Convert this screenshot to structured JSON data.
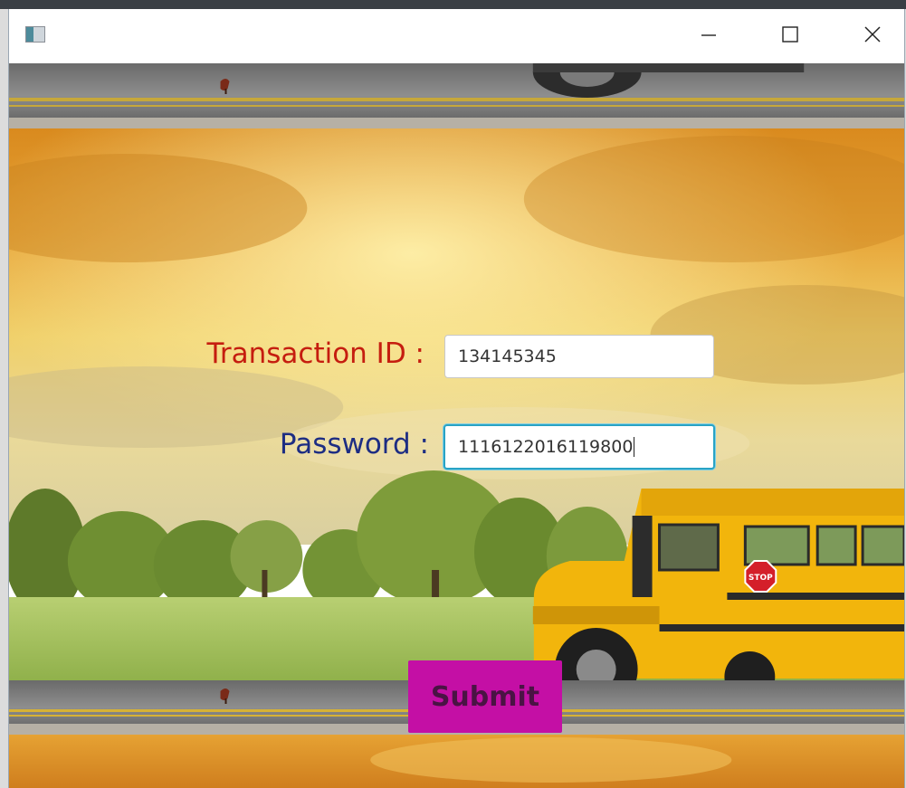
{
  "window": {
    "controls": {
      "minimize_icon": "minimize-icon",
      "maximize_icon": "maximize-icon",
      "close_icon": "close-icon"
    }
  },
  "form": {
    "transaction_label": "Transaction ID :",
    "transaction_value": "134145345",
    "password_label": "Password :",
    "password_value": "1116122016119800",
    "submit_label": "Submit"
  },
  "background": {
    "sign_text": "STOP"
  },
  "colors": {
    "transaction_label": "#c51d0f",
    "password_label": "#1d2d83",
    "submit_bg": "#c40fa5",
    "submit_text": "#4a1344",
    "focus_border": "#2aa3c4",
    "bus_yellow": "#f2b50c"
  }
}
